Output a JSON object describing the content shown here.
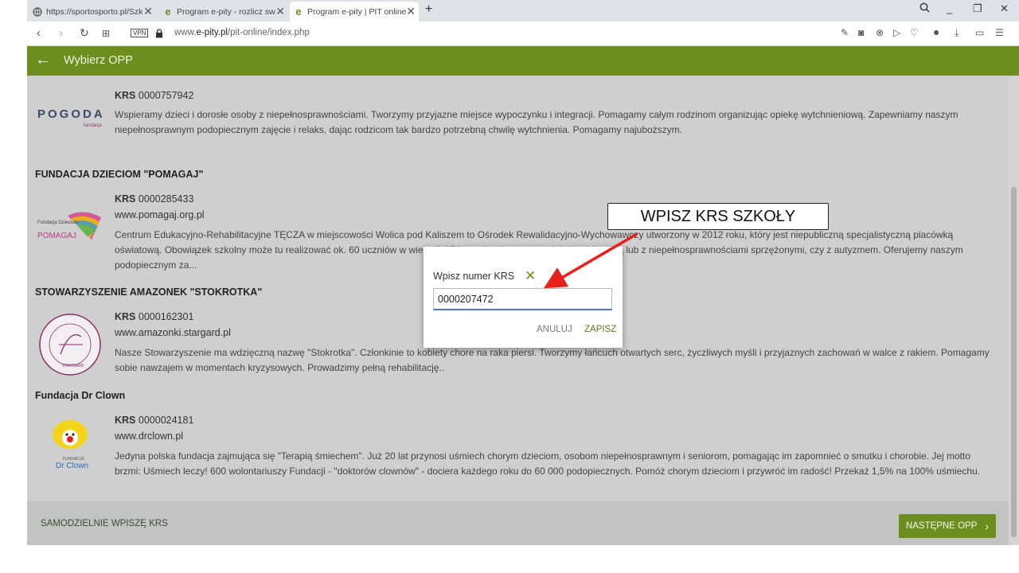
{
  "browser": {
    "tabs": [
      {
        "label": "https://sportosporto.pl/Szk",
        "icon": "globe-icon"
      },
      {
        "label": "Program e-pity - rozlicz sw",
        "icon": "epity-icon"
      },
      {
        "label": "Program e-pity | PIT online",
        "icon": "epity-icon"
      }
    ],
    "url_prefix": "www.",
    "url_domain": "e-pity.pl",
    "url_path": "/pit-online/index.php",
    "vpn_label": "VPN"
  },
  "header": {
    "title": "Wybierz OPP"
  },
  "organizations": [
    {
      "name": "",
      "krs_label": "KRS",
      "krs": "0000757942",
      "www": "",
      "logo_text": "POGODA",
      "logo_subtext": "fundacja",
      "description": "Wspieramy dzieci i dorosłe osoby z niepełnosprawnościami. Tworzymy przyjazne miejsce wypoczynku i integracji. Pomagamy całym rodzinom organizując opiekę wytchnieniową. Zapewniamy naszym niepełnosprawnym podopiecznym zajęcie i relaks, dając rodzicom tak bardzo potrzebną chwilę wytchnienia. Pomagamy najuboższym."
    },
    {
      "name": "FUNDACJA DZIECIOM \"POMAGAJ\"",
      "krs_label": "KRS",
      "krs": "0000285433",
      "www": "www.pomagaj.org.pl",
      "logo_text": "POMAGAJ",
      "logo_subtext": "Fundacja Dzieciom",
      "description": "Centrum Edukacyjno-Rehabilitacyjne TĘCZA w miejscowości Wolica pod Kaliszem to Ośrodek Rewalidacyjno-Wychowawczy utworzony w 2012 roku, który jest niepubliczną specjalistyczną placówką oświatową. Obowiązek szkolny może tu realizować ok. 60 uczniów w wieku 3-25 lat z niepełnosprawnością intelektualną lub z niepełnosprawnościami sprzężonymi, czy z autyzmem. Oferujemy naszym podopiecznym za..."
    },
    {
      "name": "STOWARZYSZENIE AMAZONEK \"STOKROTKA\"",
      "krs_label": "KRS",
      "krs": "0000162301",
      "www": "www.amazonki.stargard.pl",
      "logo_text": "STOWARZYSZENIE AMAZONEK STOKROTKA",
      "logo_subtext": "STARGARD",
      "description": "Nasze Stowarzyszenie ma wdzięczną nazwę \"Stokrotka\". Członkinie to kobiety chore na raka piersi. Tworzymy łańcuch otwartych serc, życzliwych myśli i przyjaznych zachowań w walce z rakiem. Pomagamy sobie nawzajem w momentach kryzysowych. Prowadzimy pełną rehabilitację.."
    },
    {
      "name": "Fundacja Dr Clown",
      "krs_label": "KRS",
      "krs": "0000024181",
      "www": "www.drclown.pl",
      "logo_text": "Dr Clown",
      "logo_subtext": "FUNDACJA",
      "description": "Jedyna polska fundacja zajmująca się \"Terapią śmiechem\". Już 20 lat przynosi uśmiech chorym dzieciom, osobom niepełnosprawnym i seniorom, pomagając im zapomnieć o smutku i chorobie. Jej motto brzmi: Uśmiech leczy! 600 wolontariuszy Fundacji - \"doktorów clownów\" - dociera każdego roku do 60 000 podopiecznych. Pomóż chorym dzieciom i przywróć im radość! Przekaż 1,5% na 100% uśmiechu."
    }
  ],
  "footer": {
    "self_krs_label": "SAMODZIELNIE WPISZĘ KRS",
    "next_label": "NASTĘPNE OPP"
  },
  "dialog": {
    "title": "Wpisz numer KRS",
    "value": "0000207472",
    "cancel_label": "ANULUJ",
    "save_label": "ZAPISZ"
  },
  "callout": {
    "text": "WPISZ KRS SZKOŁY"
  },
  "colors": {
    "accent_green": "#6b8e1e",
    "annotation_red": "#e8201a"
  }
}
